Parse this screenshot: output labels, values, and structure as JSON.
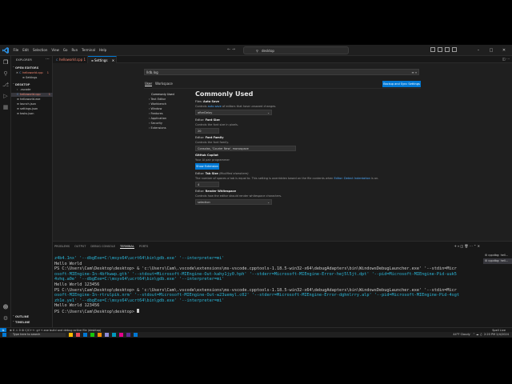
{
  "titlebar": {
    "menu": [
      "File",
      "Edit",
      "Selection",
      "View",
      "Go",
      "Run",
      "Terminal",
      "Help"
    ],
    "command_center": "desktop"
  },
  "sidebar": {
    "title": "EXPLORER",
    "open_editors_label": "OPEN EDITORS",
    "open_editors": [
      {
        "label": "helloworld.cpp",
        "badge": "1",
        "modified": true
      },
      {
        "label": "Settings",
        "badge": "",
        "modified": false
      }
    ],
    "folder_label": "DESKTOP",
    "files": [
      {
        "label": ".vscode",
        "color": "#cccccc"
      },
      {
        "label": "helloworld.cpp",
        "badge": "1",
        "color": "#f48771"
      },
      {
        "label": "helloworld.exe",
        "color": "#cccccc"
      },
      {
        "label": "launch.json",
        "color": "#cccccc"
      },
      {
        "label": "settings.json",
        "color": "#cccccc"
      },
      {
        "label": "tasks.json",
        "color": "#cccccc"
      }
    ],
    "outline_label": "OUTLINE",
    "timeline_label": "TIMELINE"
  },
  "tabs": [
    {
      "label": "helloworld.cpp 1"
    },
    {
      "label": "Settings"
    }
  ],
  "settings": {
    "search_value": "lldb.log",
    "scope_tabs": [
      "User",
      "Workspace"
    ],
    "backup_button": "Backup and Sync Settings",
    "toc": [
      "Commonly Used",
      "Text Editor",
      "Workbench",
      "Window",
      "Features",
      "Application",
      "Security",
      "Extensions"
    ],
    "heading": "Commonly Used",
    "items": [
      {
        "category": "Files: ",
        "name": "Auto Save",
        "desc_pre": "Controls ",
        "desc_link": "auto save",
        "desc_post": " of editors that have unsaved changes.",
        "control": "dropdown",
        "value": "afterDelay"
      },
      {
        "category": "Editor: ",
        "name": "Font Size",
        "desc_pre": "Controls the font size in pixels.",
        "desc_link": "",
        "desc_post": "",
        "control": "input",
        "value": "20"
      },
      {
        "category": "Editor: ",
        "name": "Font Family",
        "desc_pre": "Controls the font family.",
        "desc_link": "",
        "desc_post": "",
        "control": "input-wide",
        "value": "Consolas, 'Courier New', monospace"
      },
      {
        "category": "",
        "name": "GitHub Copilot",
        "desc_pre": "Your AI pair programmer",
        "desc_link": "",
        "desc_post": "",
        "control": "button",
        "value": "Show Extension"
      },
      {
        "category": "Editor: ",
        "name": "Tab Size",
        "name_extra": " (Modified elsewhere)",
        "desc_pre": "The number of spaces a tab is equal to. This setting is overridden based on the file contents when ",
        "desc_link": "Editor: Detect Indentation",
        "desc_post": " is on.",
        "control": "input",
        "value": "4"
      },
      {
        "category": "Editor: ",
        "name": "Render Whitespace",
        "desc_pre": "Controls how the editor should render whitespace characters.",
        "desc_link": "",
        "desc_post": "",
        "control": "dropdown",
        "value": "selection"
      }
    ]
  },
  "panel": {
    "tabs": [
      "PROBLEMS",
      "OUTPUT",
      "DEBUG CONSOLE",
      "TERMINAL",
      "PORTS"
    ],
    "active_tab": "TERMINAL",
    "terminal_list": [
      "cppdbg: hell...",
      "cppdbg: hell..."
    ],
    "terminal_lines": [
      "z4b4.1nx' '--dbgExe=C:\\msys64\\ucrt64\\bin\\gdb.exe' '--interpreter=mi'",
      "Hello World",
      "PS C:\\Users\\Cam\\Desktop\\desktop> & 'c:\\Users\\Cam\\.vscode\\extensions\\ms-vscode.cpptools-1.18.5-win32-x64\\debugAdapters\\bin\\WindowsDebugLauncher.exe' '--stdin=Micr",
      "osoft-MIEngine-In-4bfkwwp.gth' '--stdout=Microsoft-MIEngine-Out-kahy1jy0.hph' '--stderr=Microsoft-MIEngine-Error-hej5l5jt.dpt' '--pid=Microsoft-MIEngine-Pid-uuk5",
      "4vhq.a0e' '--dbgExe=C:\\msys64\\ucrt64\\bin\\gdb.exe' '--interpreter=mi'",
      "Hello World 123456",
      "PS C:\\Users\\Cam\\Desktop\\desktop> & 'c:\\Users\\Cam\\.vscode\\extensions\\ms-vscode.cpptools-1.18.5-win32-x64\\debugAdapters\\bin\\WindowsDebugLauncher.exe' '--stdin=Micr",
      "osoft-MIEngine-In-rtrulpik.nrm' '--stdout=Microsoft-MIEngine-Out-w23uemyl.c02' '--stderr=Microsoft-MIEngine-Error-dghnlrry.alp' '--pid=Microsoft-MIEngine-Pid-4sgt",
      "zh1e.ye1' '--dbgExe=C:\\msys64\\ucrt64\\bin\\gdb.exe' '--interpreter=mi'",
      "Hello World 123456",
      "PS C:\\Users\\Cam\\Desktop\\desktop> "
    ]
  },
  "statusbar": {
    "left": "⊗ 0 ⚠ 0    ⚙ C/C++: g++.exe build and debug active file (desktop)",
    "right": "Spell Live"
  },
  "taskbar": {
    "search_placeholder": "Type here to search",
    "tray_weather": "44°F Cloudy",
    "tray_time": "2:20 PM",
    "tray_date": "2/4/2024",
    "app_colors": [
      "#ffb900",
      "#e74856",
      "#0078d4",
      "#16c60c",
      "#ff8c00",
      "#8e8cd8",
      "#0099bc",
      "#e3008c",
      "#5c2d91",
      "#0078d4"
    ]
  },
  "colors": {
    "accent": "#0078d4",
    "error": "#f48771",
    "background": "#1e1e1e"
  }
}
